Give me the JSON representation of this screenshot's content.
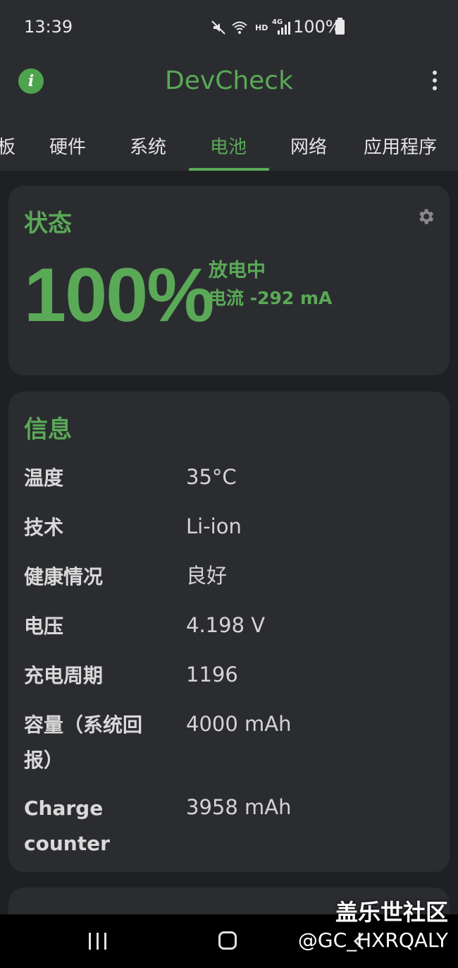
{
  "status_bar": {
    "time": "13:39",
    "network_label": "HD",
    "signal_label": "4G",
    "battery_percent": "100%"
  },
  "app_bar": {
    "title": "DevCheck",
    "tabs": [
      {
        "label": "板"
      },
      {
        "label": "硬件"
      },
      {
        "label": "系统"
      },
      {
        "label": "电池",
        "active": true
      },
      {
        "label": "网络"
      },
      {
        "label": "应用程序"
      }
    ]
  },
  "status_card": {
    "title": "状态",
    "level": "100%",
    "state": "放电中",
    "current": "电流 -292 mA"
  },
  "info_card": {
    "title": "信息",
    "rows": [
      {
        "label": "温度",
        "value": "35°C"
      },
      {
        "label": "技术",
        "value": "Li-ion"
      },
      {
        "label": "健康情况",
        "value": "良好"
      },
      {
        "label": "电压",
        "value": "4.198 V"
      },
      {
        "label": "充电周期",
        "value": "1196"
      },
      {
        "label": "容量（系统回报）",
        "value": "4000 mAh"
      },
      {
        "label": "Charge counter",
        "value": "3958 mAh"
      }
    ]
  },
  "watermark": {
    "title": "盖乐世社区",
    "user": "@GC_HXRQALY"
  },
  "colors": {
    "accent": "#5aa957",
    "background": "#1f2023",
    "card": "#2b2c30"
  }
}
